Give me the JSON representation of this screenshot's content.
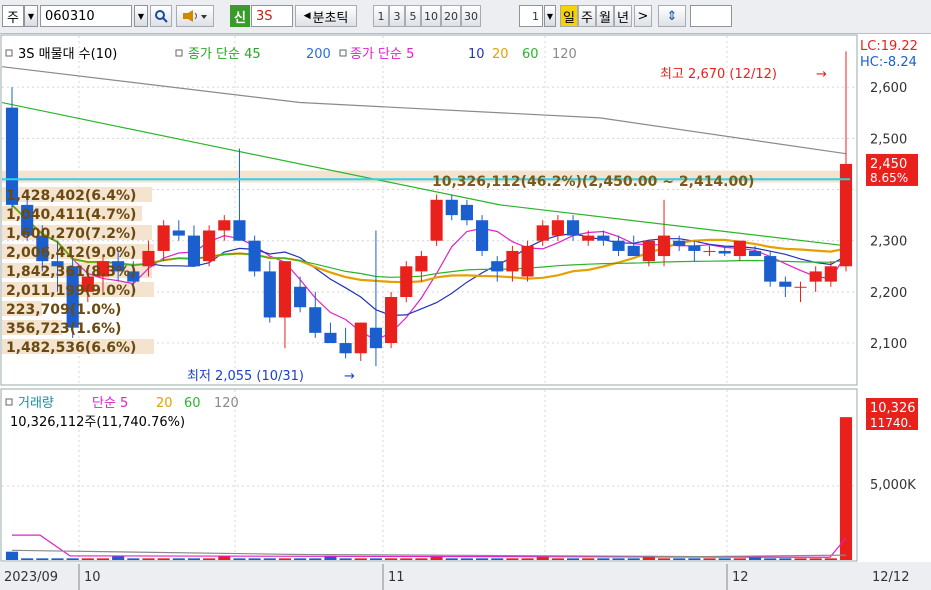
{
  "toolbar": {
    "market": "주",
    "code": "060310",
    "badge_new": "신",
    "name": "3S",
    "period_label": "분초틱",
    "intervals": [
      "1",
      "3",
      "5",
      "10",
      "20",
      "30"
    ],
    "count_value": "1",
    "active_period": "일",
    "periods": [
      "주",
      "월",
      "년"
    ]
  },
  "price_legend": {
    "name": "3S 매물대 수(10)",
    "ma_long_label": "종가 단순 45",
    "ma_long_200": "200",
    "ma_short_label": "종가 단순 5",
    "ma_10": "10",
    "ma_20": "20",
    "ma_60": "60",
    "ma_120": "120"
  },
  "volume_legend": {
    "label": "거래량",
    "ma_label": "단순 5",
    "ma_20": "20",
    "ma_60": "60",
    "ma_120": "120",
    "today": "10,326,112주(11,740.76%)"
  },
  "annotations": {
    "high": "최고 2,670 (12/12)",
    "low": "최저 2,055 (10/31)",
    "volume_profile_top": "10,326,112(46.2%)(2,450.00 ~ 2,414.00)"
  },
  "volume_profile": [
    "1,428,402(6.4%)",
    "1,040,411(4.7%)",
    "1,600,270(7.2%)",
    "2,006,412(9.0%)",
    "1,842,361(8.3%)",
    "2,011,199(9.0%)",
    "223,709(1.0%)",
    "356,723(1.6%)",
    "1,482,536(6.6%)"
  ],
  "right_axis": {
    "lc": "LC:19.22",
    "hc": "HC:-8.24",
    "ticks": [
      "2,600",
      "2,500",
      "2,450",
      "2,300",
      "2,200",
      "2,100"
    ],
    "current_price": "2,450",
    "current_pct": "8.65%",
    "volume_current": "10,326",
    "volume_pct": "11740.",
    "volume_tick": "5,000K"
  },
  "x_axis": {
    "labels": [
      "2023/09",
      "10",
      "11",
      "12"
    ],
    "end_date": "12/12"
  },
  "colors": {
    "up": "#e8211c",
    "down": "#1b5fcf",
    "ma5": "#e020c8",
    "ma10": "#2133b8",
    "ma20": "#e6a000",
    "ma60": "#2bb52b",
    "ma120": "#8a8a8a",
    "current_line": "#2ad4ea"
  },
  "chart_data": {
    "type": "candlestick",
    "title": "3S",
    "y_range": [
      2020,
      2700
    ],
    "candles": [
      {
        "o": 2560,
        "h": 2600,
        "l": 2350,
        "c": 2370
      },
      {
        "o": 2370,
        "h": 2390,
        "l": 2300,
        "c": 2310
      },
      {
        "o": 2310,
        "h": 2330,
        "l": 2240,
        "c": 2260
      },
      {
        "o": 2260,
        "h": 2300,
        "l": 2200,
        "c": 2250
      },
      {
        "o": 2250,
        "h": 2270,
        "l": 2110,
        "c": 2130
      },
      {
        "o": 2200,
        "h": 2240,
        "l": 2180,
        "c": 2230
      },
      {
        "o": 2230,
        "h": 2270,
        "l": 2200,
        "c": 2260
      },
      {
        "o": 2260,
        "h": 2280,
        "l": 2220,
        "c": 2240
      },
      {
        "o": 2240,
        "h": 2260,
        "l": 2200,
        "c": 2220
      },
      {
        "o": 2250,
        "h": 2300,
        "l": 2230,
        "c": 2280
      },
      {
        "o": 2280,
        "h": 2340,
        "l": 2260,
        "c": 2330
      },
      {
        "o": 2320,
        "h": 2340,
        "l": 2300,
        "c": 2310
      },
      {
        "o": 2310,
        "h": 2330,
        "l": 2260,
        "c": 2250
      },
      {
        "o": 2260,
        "h": 2330,
        "l": 2250,
        "c": 2320
      },
      {
        "o": 2320,
        "h": 2350,
        "l": 2300,
        "c": 2340
      },
      {
        "o": 2340,
        "h": 2480,
        "l": 2300,
        "c": 2300
      },
      {
        "o": 2300,
        "h": 2310,
        "l": 2230,
        "c": 2240
      },
      {
        "o": 2240,
        "h": 2260,
        "l": 2140,
        "c": 2150
      },
      {
        "o": 2150,
        "h": 2260,
        "l": 2090,
        "c": 2260
      },
      {
        "o": 2210,
        "h": 2230,
        "l": 2160,
        "c": 2170
      },
      {
        "o": 2170,
        "h": 2200,
        "l": 2110,
        "c": 2120
      },
      {
        "o": 2120,
        "h": 2140,
        "l": 2100,
        "c": 2100
      },
      {
        "o": 2100,
        "h": 2130,
        "l": 2070,
        "c": 2080
      },
      {
        "o": 2080,
        "h": 2140,
        "l": 2065,
        "c": 2140
      },
      {
        "o": 2130,
        "h": 2320,
        "l": 2055,
        "c": 2090
      },
      {
        "o": 2100,
        "h": 2200,
        "l": 2090,
        "c": 2190
      },
      {
        "o": 2190,
        "h": 2260,
        "l": 2180,
        "c": 2250
      },
      {
        "o": 2240,
        "h": 2280,
        "l": 2220,
        "c": 2270
      },
      {
        "o": 2300,
        "h": 2390,
        "l": 2290,
        "c": 2380
      },
      {
        "o": 2380,
        "h": 2390,
        "l": 2340,
        "c": 2350
      },
      {
        "o": 2370,
        "h": 2380,
        "l": 2330,
        "c": 2340
      },
      {
        "o": 2340,
        "h": 2350,
        "l": 2270,
        "c": 2280
      },
      {
        "o": 2260,
        "h": 2270,
        "l": 2220,
        "c": 2240
      },
      {
        "o": 2240,
        "h": 2290,
        "l": 2220,
        "c": 2280
      },
      {
        "o": 2230,
        "h": 2300,
        "l": 2220,
        "c": 2290
      },
      {
        "o": 2300,
        "h": 2340,
        "l": 2290,
        "c": 2330
      },
      {
        "o": 2310,
        "h": 2350,
        "l": 2300,
        "c": 2340
      },
      {
        "o": 2340,
        "h": 2350,
        "l": 2300,
        "c": 2310
      },
      {
        "o": 2300,
        "h": 2320,
        "l": 2290,
        "c": 2310
      },
      {
        "o": 2310,
        "h": 2320,
        "l": 2290,
        "c": 2300
      },
      {
        "o": 2300,
        "h": 2310,
        "l": 2270,
        "c": 2280
      },
      {
        "o": 2290,
        "h": 2310,
        "l": 2270,
        "c": 2270
      },
      {
        "o": 2260,
        "h": 2300,
        "l": 2250,
        "c": 2300
      },
      {
        "o": 2270,
        "h": 2380,
        "l": 2250,
        "c": 2310
      },
      {
        "o": 2300,
        "h": 2310,
        "l": 2280,
        "c": 2290
      },
      {
        "o": 2290,
        "h": 2300,
        "l": 2260,
        "c": 2280
      },
      {
        "o": 2280,
        "h": 2290,
        "l": 2270,
        "c": 2280
      },
      {
        "o": 2280,
        "h": 2290,
        "l": 2270,
        "c": 2275
      },
      {
        "o": 2270,
        "h": 2300,
        "l": 2260,
        "c": 2300
      },
      {
        "o": 2280,
        "h": 2290,
        "l": 2270,
        "c": 2270
      },
      {
        "o": 2270,
        "h": 2280,
        "l": 2210,
        "c": 2220
      },
      {
        "o": 2220,
        "h": 2230,
        "l": 2190,
        "c": 2210
      },
      {
        "o": 2210,
        "h": 2220,
        "l": 2180,
        "c": 2210
      },
      {
        "o": 2220,
        "h": 2250,
        "l": 2200,
        "c": 2240
      },
      {
        "o": 2220,
        "h": 2260,
        "l": 2210,
        "c": 2250
      },
      {
        "o": 2250,
        "h": 2670,
        "l": 2240,
        "c": 2450
      }
    ],
    "volume_max_k": 12000,
    "volume_last_k": 10326
  }
}
